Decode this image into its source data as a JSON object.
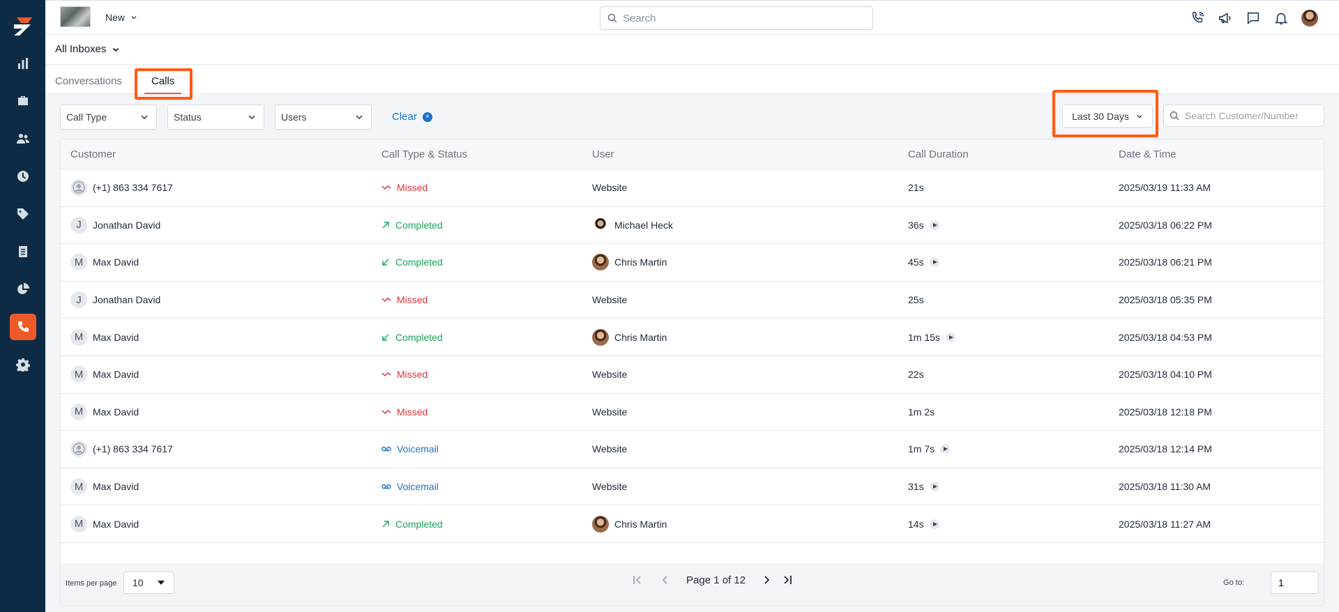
{
  "header": {
    "new_label": "New",
    "search_placeholder": "Search",
    "icons": [
      "phone-icon",
      "megaphone-icon",
      "chat-icon",
      "bell-icon",
      "avatar"
    ]
  },
  "sidebar": {
    "items": [
      {
        "icon": "bar-chart-icon"
      },
      {
        "icon": "briefcase-icon"
      },
      {
        "icon": "users-icon"
      },
      {
        "icon": "clock-icon"
      },
      {
        "icon": "tag-icon"
      },
      {
        "icon": "document-icon"
      },
      {
        "icon": "pie-chart-icon"
      },
      {
        "icon": "phone-icon",
        "active": true
      },
      {
        "icon": "gear-icon"
      }
    ],
    "accent_color": "#f05a28"
  },
  "inbox": {
    "label": "All Inboxes"
  },
  "tabs": [
    {
      "label": "Conversations",
      "active": false
    },
    {
      "label": "Calls",
      "active": true
    }
  ],
  "filters": {
    "call_type": "Call Type",
    "status": "Status",
    "users": "Users",
    "clear": "Clear",
    "date_range": "Last 30 Days",
    "search_placeholder": "Search Customer/Number"
  },
  "table": {
    "columns": [
      "Customer",
      "Call Type & Status",
      "User",
      "Call Duration",
      "Date & Time"
    ],
    "rows": [
      {
        "customer": "(+1) 863 334 7617",
        "avatar": "anon",
        "status": "Missed",
        "user": "Website",
        "duration": "21s",
        "datetime": "2025/03/19 11:33 AM"
      },
      {
        "customer": "Jonathan David",
        "avatar": "J",
        "status": "Completed",
        "user": "Michael Heck",
        "duration": "36s",
        "datetime": "2025/03/18 06:22 PM"
      },
      {
        "customer": "Max David",
        "avatar": "M",
        "status": "Completed",
        "user": "Chris Martin",
        "duration": "45s",
        "datetime": "2025/03/18 06:21 PM"
      },
      {
        "customer": "Jonathan David",
        "avatar": "J",
        "status": "Missed",
        "user": "Website",
        "duration": "25s",
        "datetime": "2025/03/18 05:35 PM"
      },
      {
        "customer": "Max David",
        "avatar": "M",
        "status": "Completed",
        "user": "Chris Martin",
        "duration": "1m 15s",
        "datetime": "2025/03/18 04:53 PM"
      },
      {
        "customer": "Max David",
        "avatar": "M",
        "status": "Missed",
        "user": "Website",
        "duration": "22s",
        "datetime": "2025/03/18 04:10 PM"
      },
      {
        "customer": "Max David",
        "avatar": "M",
        "status": "Missed",
        "user": "Website",
        "duration": "1m 2s",
        "datetime": "2025/03/18 12:18 PM"
      },
      {
        "customer": "(+1) 863 334 7617",
        "avatar": "anon",
        "status": "Voicemail",
        "user": "Website",
        "duration": "1m 7s",
        "datetime": "2025/03/18 12:14 PM"
      },
      {
        "customer": "Max David",
        "avatar": "M",
        "status": "Voicemail",
        "user": "Website",
        "duration": "31s",
        "datetime": "2025/03/18 11:30 AM"
      },
      {
        "customer": "Max David",
        "avatar": "M",
        "status": "Completed",
        "user": "Chris Martin",
        "duration": "14s",
        "datetime": "2025/03/18 11:27 AM"
      }
    ]
  },
  "pagination": {
    "items_per_page_label": "Items per page",
    "items_per_page": "10",
    "page_text": "Page 1 of 12",
    "goto_label": "Go to:",
    "goto_value": "1"
  },
  "colors": {
    "missed": "#e0323b",
    "completed": "#17a55a",
    "voicemail": "#1a73c9",
    "highlight": "#ff5a14"
  }
}
